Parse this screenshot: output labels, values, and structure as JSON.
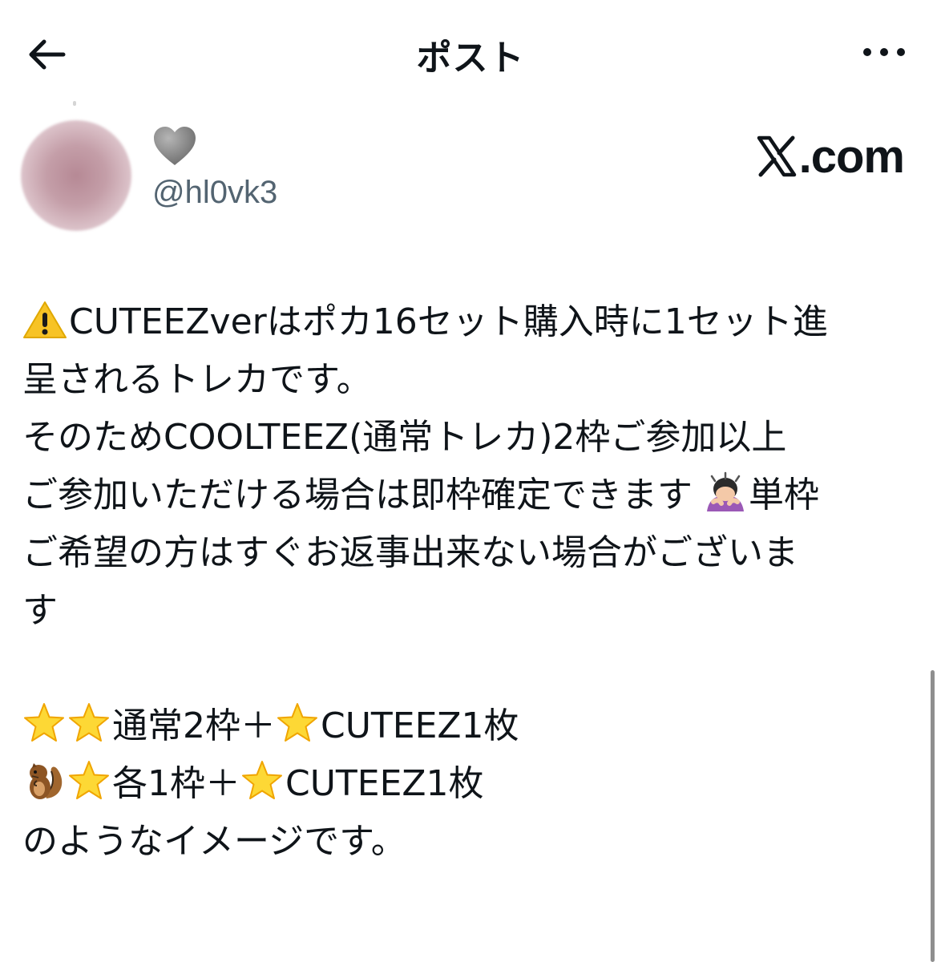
{
  "header": {
    "title": "ポスト",
    "back_icon": "arrow-left-icon",
    "more_icon": "more-horizontal-icon"
  },
  "author": {
    "display_name_emoji": "grey-heart",
    "handle": "@hl0vk3"
  },
  "watermark": {
    "text": ".com",
    "logo": "x-logo-icon"
  },
  "post": {
    "line1_text": "CUTEEZverはポカ16セット購入時に1セット進",
    "line2_text": "呈されるトレカです。",
    "line3_text": "そのためCOOLTEEZ(通常トレカ)2枠ご参加以上",
    "line4_text": "ご参加いただける場合は即枠確定できます",
    "line4_tail": "単枠",
    "line5_text": "ご希望の方はすぐお返事出来ない場合がございま",
    "line6_text": "す",
    "line7_text": "通常2枠＋",
    "line7_tail": "CUTEEZ1枚",
    "line8_text": "各1枠＋",
    "line8_tail": "CUTEEZ1枚",
    "line9_text": "のようなイメージです。"
  }
}
